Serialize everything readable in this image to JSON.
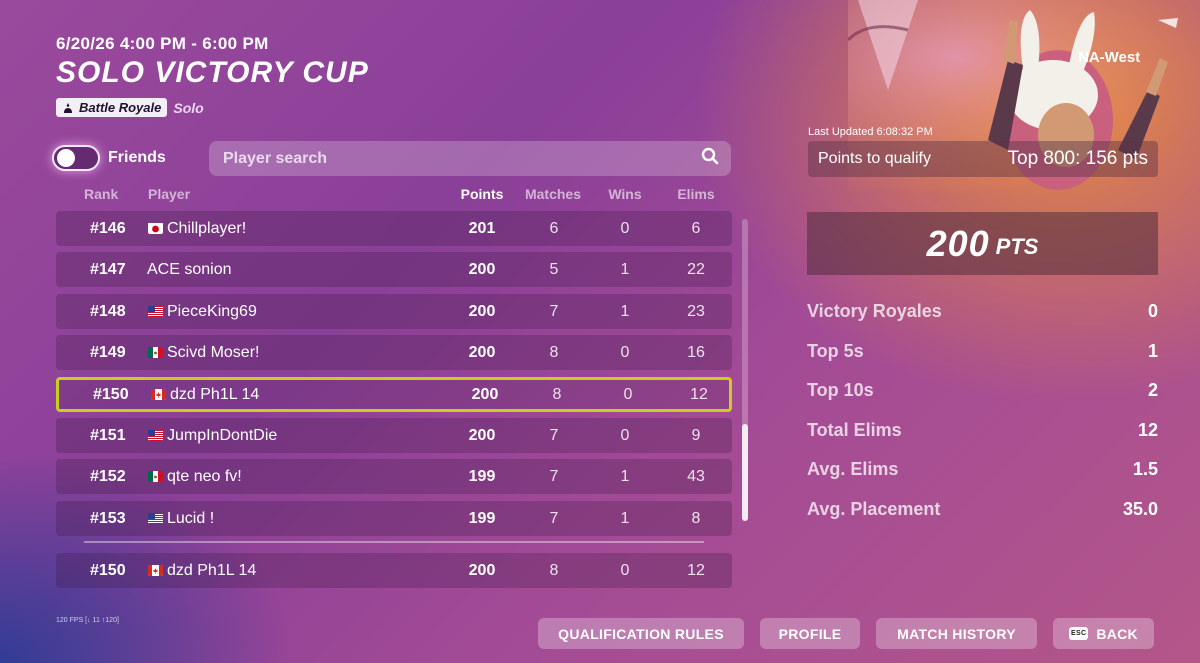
{
  "header": {
    "date_range": "6/20/26 4:00 PM - 6:00 PM",
    "title": "SOLO VICTORY CUP",
    "mode_badge": "Battle Royale",
    "mode_sub": "Solo"
  },
  "filters": {
    "friends_label": "Friends",
    "friends_toggle_on": false,
    "search_placeholder": "Player search",
    "search_value": ""
  },
  "columns": {
    "rank": "Rank",
    "player": "Player",
    "points": "Points",
    "matches": "Matches",
    "wins": "Wins",
    "elims": "Elims"
  },
  "rows": [
    {
      "rank": "#146",
      "flag": "jp",
      "player": "Chillplayer!",
      "points": "201",
      "matches": "6",
      "wins": "0",
      "elims": "6"
    },
    {
      "rank": "#147",
      "flag": "",
      "player": "ACE sonion",
      "points": "200",
      "matches": "5",
      "wins": "1",
      "elims": "22"
    },
    {
      "rank": "#148",
      "flag": "us",
      "player": "PieceKing69",
      "points": "200",
      "matches": "7",
      "wins": "1",
      "elims": "23"
    },
    {
      "rank": "#149",
      "flag": "mx",
      "player": "Scivd Moser!",
      "points": "200",
      "matches": "8",
      "wins": "0",
      "elims": "16"
    },
    {
      "rank": "#150",
      "flag": "ca",
      "player": "dzd Ph1L 14",
      "points": "200",
      "matches": "8",
      "wins": "0",
      "elims": "12"
    },
    {
      "rank": "#151",
      "flag": "us",
      "player": "JumpInDontDie",
      "points": "200",
      "matches": "7",
      "wins": "0",
      "elims": "9"
    },
    {
      "rank": "#152",
      "flag": "mx",
      "player": "qte neo fv!",
      "points": "199",
      "matches": "7",
      "wins": "1",
      "elims": "43"
    },
    {
      "rank": "#153",
      "flag": "us",
      "player": "Lucid !",
      "points": "199",
      "matches": "7",
      "wins": "1",
      "elims": "8"
    }
  ],
  "highlighted_row": 4,
  "pinned_row": {
    "rank": "#150",
    "flag": "ca",
    "player": "dzd Ph1L 14",
    "points": "200",
    "matches": "8",
    "wins": "0",
    "elims": "12"
  },
  "fps_text": "120 FPS [↓ 11 ↑120]",
  "side": {
    "region": "NA-West",
    "last_updated": "Last Updated 6:08:32 PM",
    "qualify_label": "Points to qualify",
    "qualify_value": "Top 800: 156 pts",
    "points_num": "200",
    "points_unit": "PTS",
    "stats": [
      {
        "label": "Victory Royales",
        "value": "0"
      },
      {
        "label": "Top 5s",
        "value": "1"
      },
      {
        "label": "Top 10s",
        "value": "2"
      },
      {
        "label": "Total Elims",
        "value": "12"
      },
      {
        "label": "Avg. Elims",
        "value": "1.5"
      },
      {
        "label": "Avg. Placement",
        "value": "35.0"
      }
    ]
  },
  "buttons": {
    "qualification_rules": "QUALIFICATION RULES",
    "profile": "PROFILE",
    "match_history": "MATCH HISTORY",
    "back": "BACK",
    "esc": "ESC"
  },
  "colors": {
    "highlight_border": "#c7cf1a",
    "bg_purple": "#9a4a9c",
    "bg_orange": "#e88c3c"
  },
  "icons": {
    "search": "magnifier-icon",
    "mode": "battle-royale-icon",
    "esc": "esc-key-icon"
  }
}
